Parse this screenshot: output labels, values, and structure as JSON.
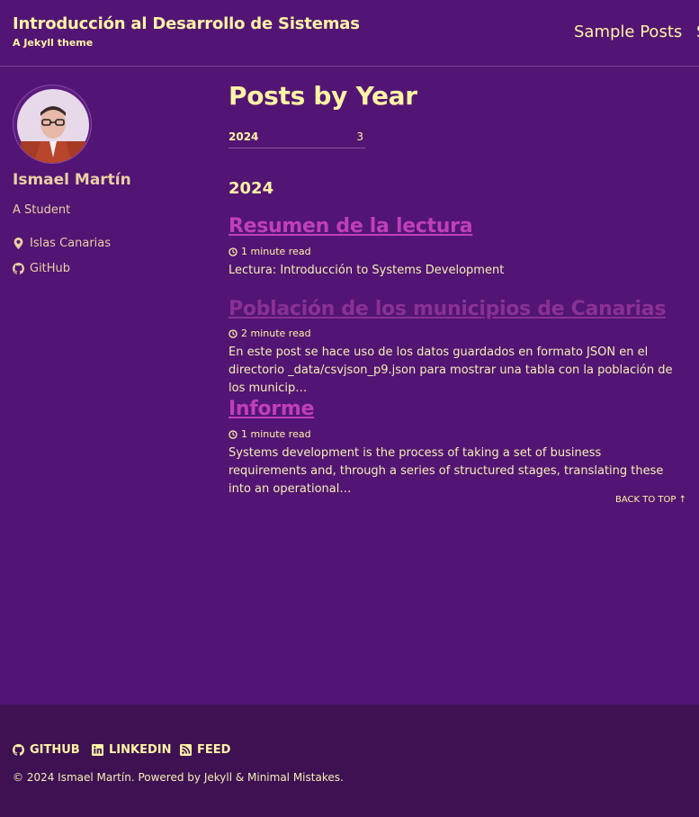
{
  "masthead": {
    "title": "Introducción al Desarrollo de Sistemas",
    "subtitle": "A Jekyll theme",
    "nav": [
      {
        "label": "Sample Posts"
      },
      {
        "label": "S"
      }
    ]
  },
  "author": {
    "name": "Ismael Martín",
    "bio": "A Student",
    "links": [
      {
        "label": "Islas Canarias",
        "icon": "map-marker-icon"
      },
      {
        "label": "GitHub",
        "icon": "github-icon"
      }
    ]
  },
  "main": {
    "title": "Posts by Year",
    "year_tab": {
      "year": "2024",
      "count": "3"
    },
    "year_heading": "2024",
    "posts": [
      {
        "title": "Resumen de la lectura",
        "read_time": "1 minute read",
        "excerpt": "Lectura: Introducción to Systems Development",
        "color": "#c03fb8"
      },
      {
        "title": "Población de los municipios de Canarias",
        "read_time": "2 minute read",
        "excerpt": "En este post se hace uso de los datos guardados en formato JSON en el directorio _data/csvjson_p9.json para mostrar una tabla con la población de los municip…",
        "color": "#8a3096"
      },
      {
        "title": "Informe",
        "read_time": "1 minute read",
        "excerpt": "Systems development is the process of taking a set of business requirements and, through a series of structured stages, translating these into an operational…",
        "color": "#c03fb8"
      }
    ],
    "back_to_top": "BACK TO TOP ↑"
  },
  "footer": {
    "links": [
      {
        "label": "GITHUB",
        "icon": "github-icon"
      },
      {
        "label": "LINKEDIN",
        "icon": "linkedin-icon"
      },
      {
        "label": "FEED",
        "icon": "rss-icon"
      }
    ],
    "copyright": "© 2024 Ismael Martín. Powered by Jekyll & Minimal Mistakes."
  },
  "colors": {
    "background": "#521573",
    "footer": "#3e1153",
    "text": "#fff3a6",
    "link": "#c03fb8"
  }
}
